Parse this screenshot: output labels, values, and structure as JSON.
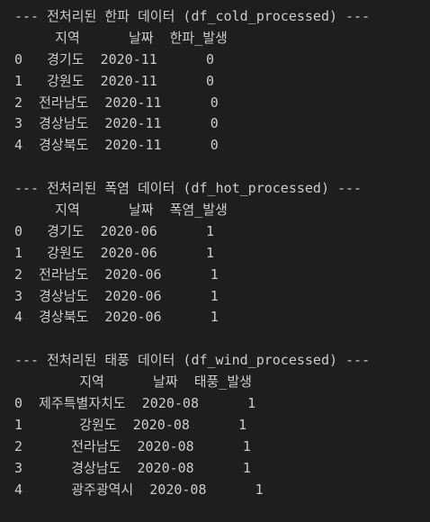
{
  "terminal": {
    "lines": [
      "--- 전처리된 한파 데이터 (df_cold_processed) ---",
      "     지역      날짜  한파_발생",
      "0   경기도  2020-11      0",
      "1   강원도  2020-11      0",
      "2  전라남도  2020-11      0",
      "3  경상남도  2020-11      0",
      "4  경상북도  2020-11      0",
      "",
      "--- 전처리된 폭염 데이터 (df_hot_processed) ---",
      "     지역      날짜  폭염_발생",
      "0   경기도  2020-06      1",
      "1   강원도  2020-06      1",
      "2  전라남도  2020-06      1",
      "3  경상남도  2020-06      1",
      "4  경상북도  2020-06      1",
      "",
      "--- 전처리된 태풍 데이터 (df_wind_processed) ---",
      "        지역      날짜  태풍_발생",
      "0  제주특별자치도  2020-08      1",
      "1       강원도  2020-08      1",
      "2      전라남도  2020-08      1",
      "3      경상남도  2020-08      1",
      "4      광주광역시  2020-08      1",
      ""
    ]
  }
}
